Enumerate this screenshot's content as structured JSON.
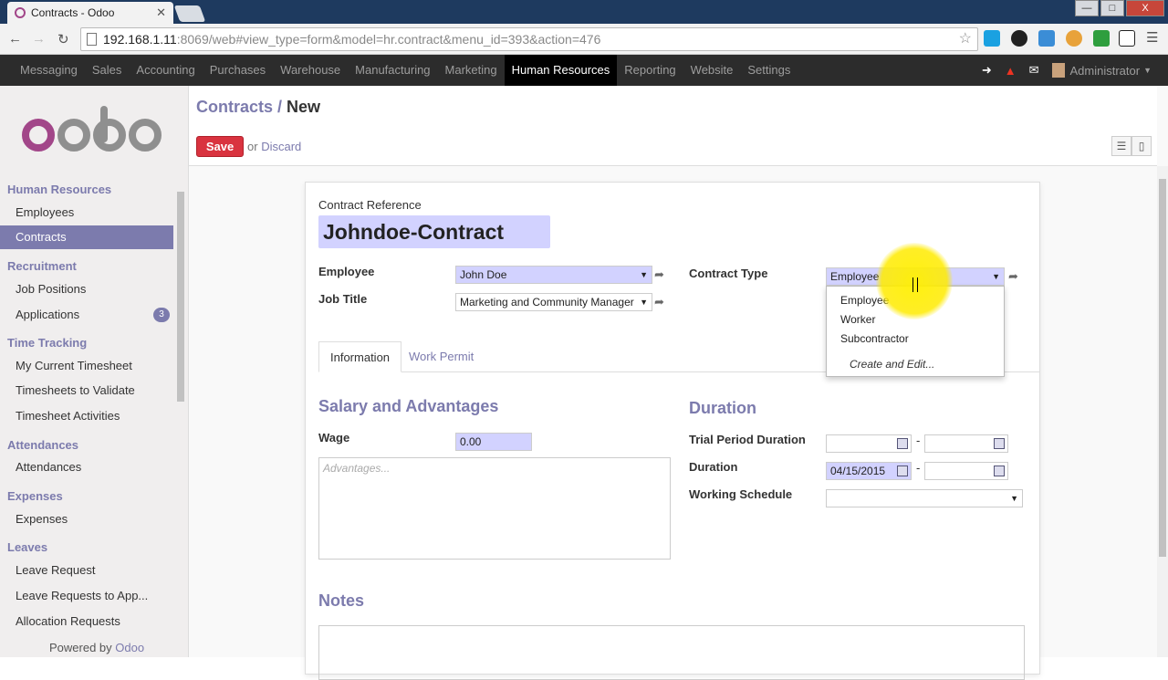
{
  "browser": {
    "tab_title": "Contracts - Odoo",
    "tab_close": "✕",
    "window_buttons": [
      "—",
      "□",
      "X"
    ],
    "url_host": "192.168.1.11",
    "url_rest": ":8069/web#view_type=form&model=hr.contract&menu_id=393&action=476"
  },
  "topmenu": {
    "items": [
      "Messaging",
      "Sales",
      "Accounting",
      "Purchases",
      "Warehouse",
      "Manufacturing",
      "Marketing",
      "Human Resources",
      "Reporting",
      "Website",
      "Settings"
    ],
    "active": "Human Resources",
    "user": "Administrator"
  },
  "sidebar": {
    "sections": [
      {
        "title": "Human Resources",
        "items": [
          {
            "label": "Employees"
          },
          {
            "label": "Contracts",
            "selected": true
          }
        ]
      },
      {
        "title": "Recruitment",
        "items": [
          {
            "label": "Job Positions"
          },
          {
            "label": "Applications",
            "badge": "3"
          }
        ]
      },
      {
        "title": "Time Tracking",
        "items": [
          {
            "label": "My Current Timesheet"
          },
          {
            "label": "Timesheets to Validate"
          },
          {
            "label": "Timesheet Activities"
          }
        ]
      },
      {
        "title": "Attendances",
        "items": [
          {
            "label": "Attendances"
          }
        ]
      },
      {
        "title": "Expenses",
        "items": [
          {
            "label": "Expenses"
          }
        ]
      },
      {
        "title": "Leaves",
        "items": [
          {
            "label": "Leave Request"
          },
          {
            "label": "Leave Requests to App..."
          },
          {
            "label": "Allocation Requests"
          }
        ]
      }
    ],
    "powered_prefix": "Powered by",
    "powered_brand": "Odoo"
  },
  "control": {
    "breadcrumb_parent": "Contracts",
    "breadcrumb_sep": " / ",
    "breadcrumb_current": "New",
    "save_label": "Save",
    "or_label": "or",
    "discard_label": "Discard"
  },
  "form": {
    "ref_label": "Contract Reference",
    "ref_value": "Johndoe-Contract",
    "employee_label": "Employee",
    "employee_value": "John Doe",
    "job_label": "Job Title",
    "job_value": "Marketing and Community Manager",
    "contract_type_label": "Contract Type",
    "contract_type_value": "Employee",
    "tabs": [
      "Information",
      "Work Permit"
    ],
    "salary_heading": "Salary and Advantages",
    "wage_label": "Wage",
    "wage_value": "0.00",
    "advantages_placeholder": "Advantages...",
    "duration_heading": "Duration",
    "trial_label": "Trial Period Duration",
    "duration_label": "Duration",
    "duration_start": "04/15/2015",
    "schedule_label": "Working Schedule",
    "notes_heading": "Notes",
    "range_dash": "-"
  },
  "dropdown": {
    "options": [
      "Employee",
      "Worker",
      "Subcontractor"
    ],
    "create_label": "Create and Edit..."
  }
}
